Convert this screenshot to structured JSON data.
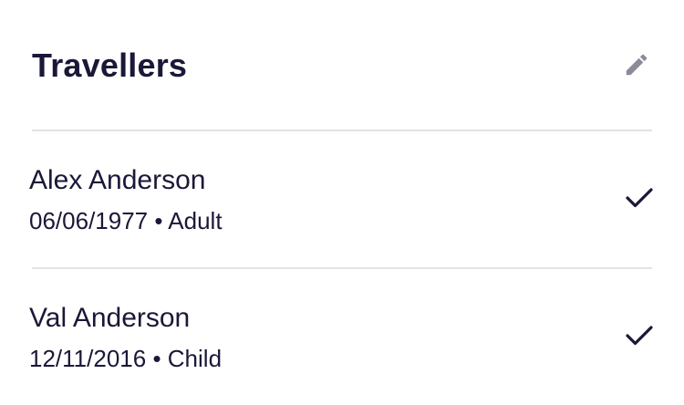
{
  "travellers_section": {
    "title": "Travellers",
    "edit_icon": "pencil-icon",
    "selected_icon": "checkmark-icon",
    "colors": {
      "text": "#1a1838",
      "icon_muted": "#8d8b99",
      "divider": "#e3e3e6"
    },
    "items": [
      {
        "name": "Alex Anderson",
        "dob": "06/06/1977",
        "separator": "•",
        "type": "Adult",
        "selected": true
      },
      {
        "name": "Val Anderson",
        "dob": "12/11/2016",
        "separator": "•",
        "type": "Child",
        "selected": true
      }
    ]
  }
}
